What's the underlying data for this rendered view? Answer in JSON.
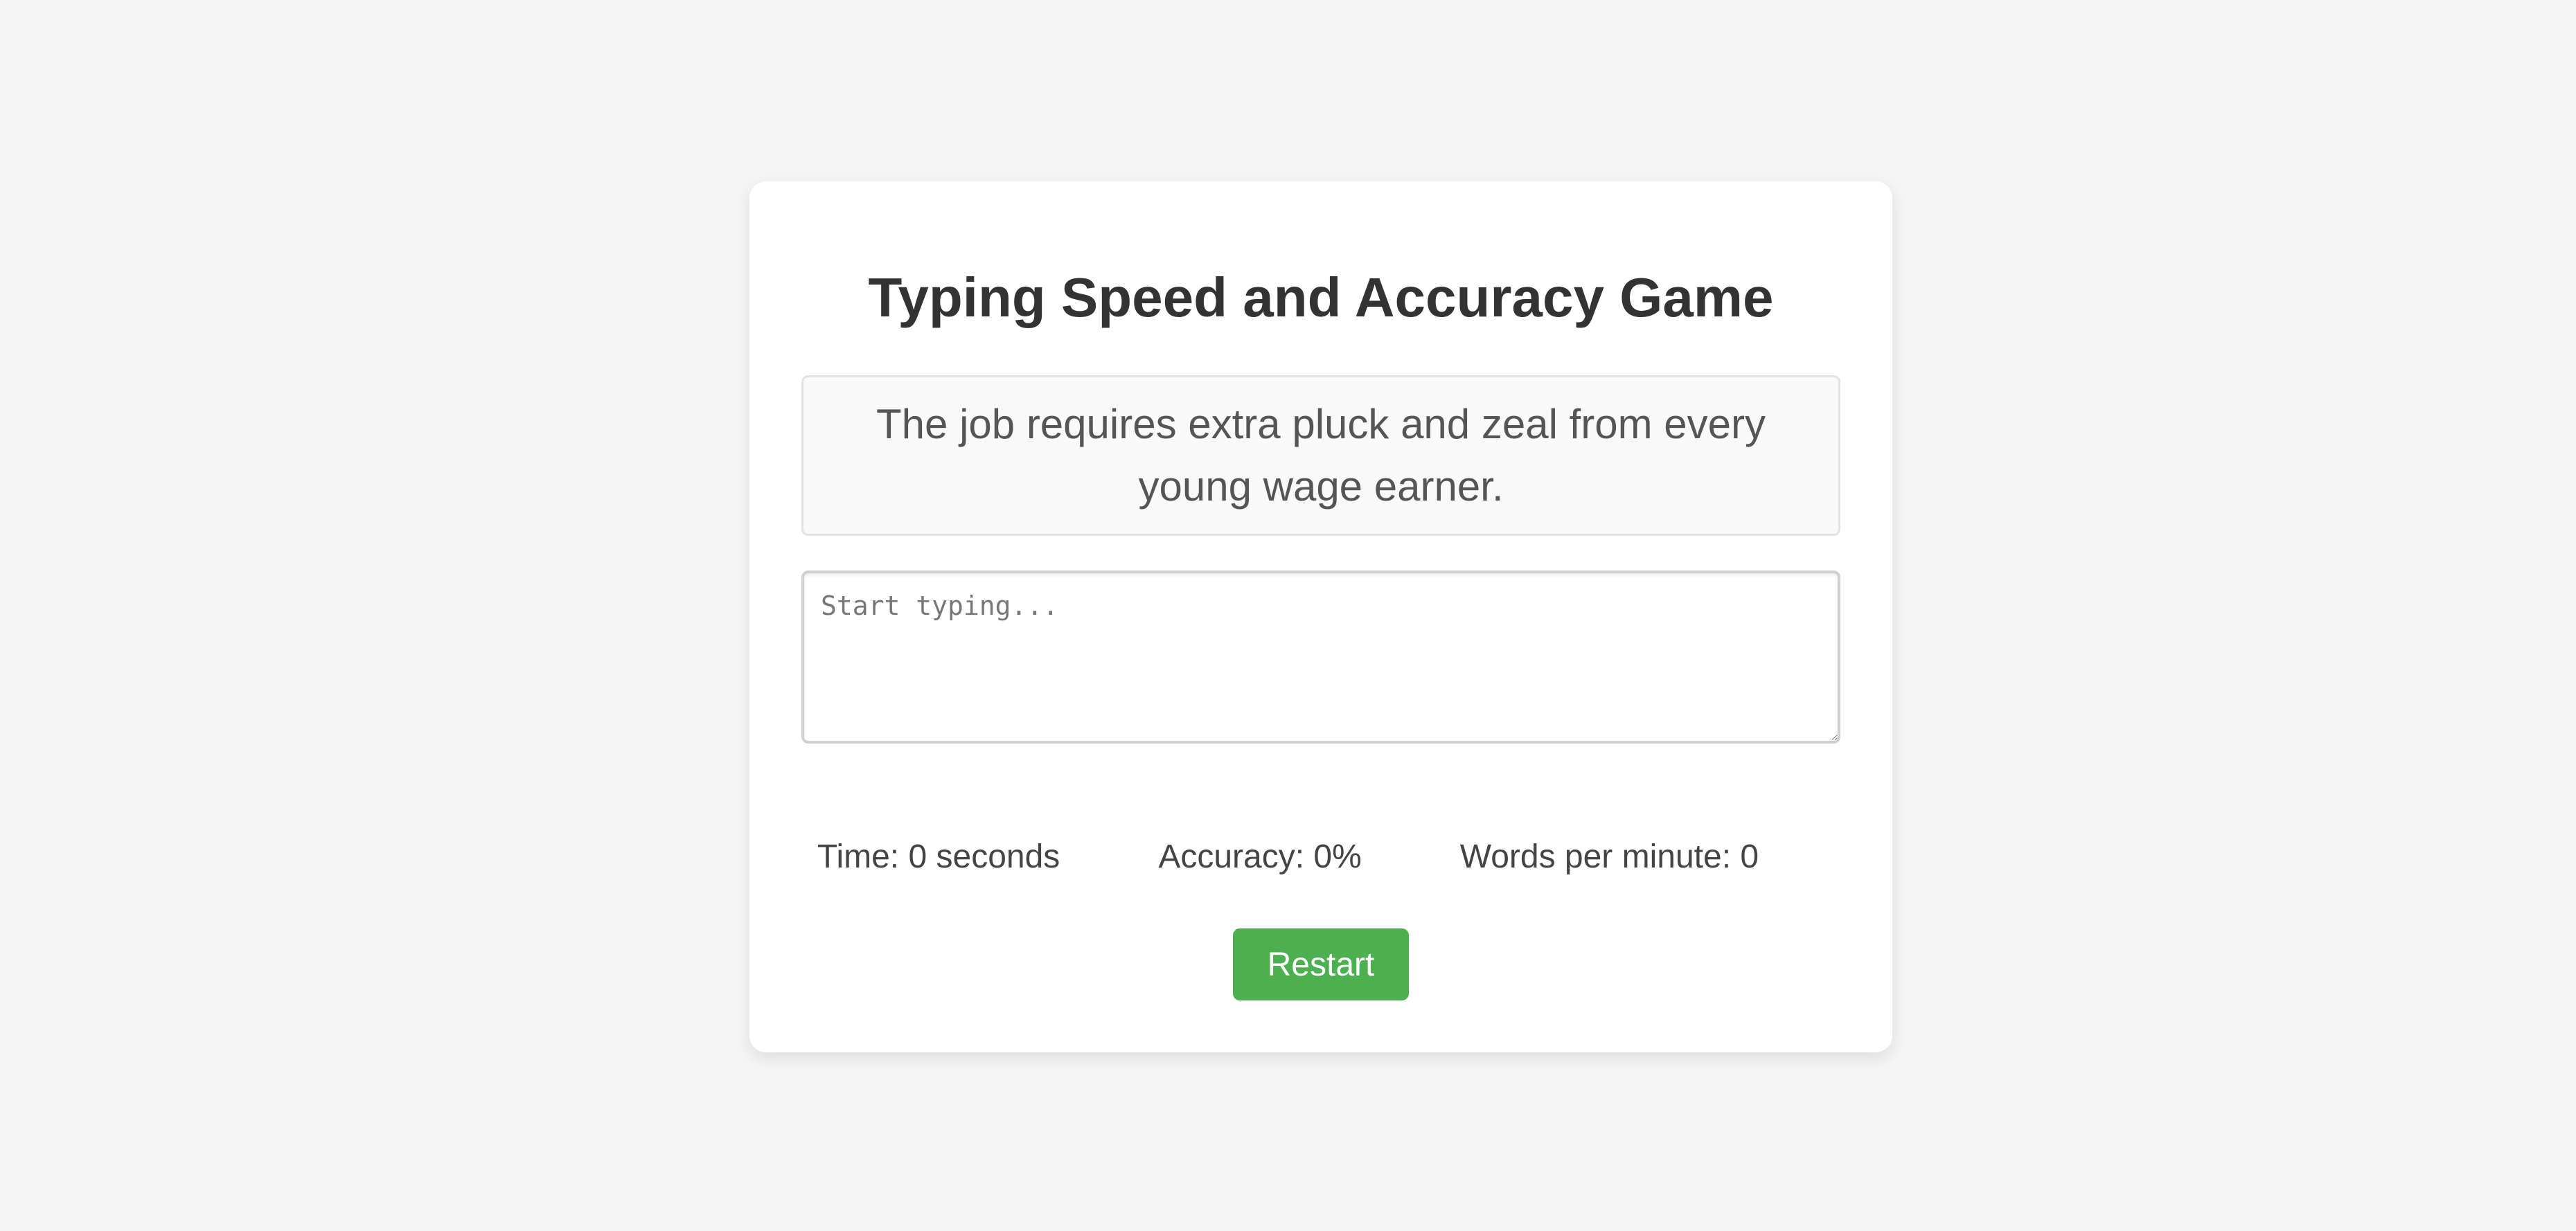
{
  "game": {
    "title": "Typing Speed and Accuracy Game",
    "sentence": "The job requires extra pluck and zeal from every young wage earner.",
    "input": {
      "value": "",
      "placeholder": "Start typing..."
    },
    "stats": {
      "time_prefix": "Time: ",
      "time_value": "0",
      "time_suffix": " seconds",
      "accuracy_prefix": "Accuracy: ",
      "accuracy_value": "0",
      "accuracy_suffix": "%",
      "wpm_prefix": "Words per minute: ",
      "wpm_value": "0"
    },
    "restart_label": "Restart"
  },
  "colors": {
    "background": "#f5f5f5",
    "card": "#ffffff",
    "title": "#333333",
    "sentence_text": "#555555",
    "sentence_box": "#f9f9f9",
    "button": "#4caf50",
    "button_text": "#ffffff"
  }
}
